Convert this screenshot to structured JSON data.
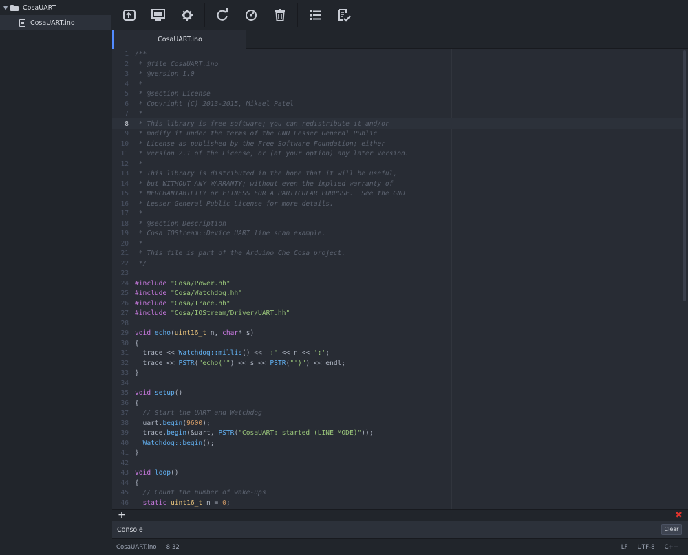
{
  "sidebar": {
    "project": "CosaUART",
    "file": "CosaUART.ino"
  },
  "toolbar": {
    "buttons": [
      "upload-icon",
      "serial-monitor-icon",
      "settings-icon",
      "refresh-icon",
      "verify-icon",
      "delete-icon",
      "list-icon",
      "edit-list-icon"
    ]
  },
  "tab": {
    "title": "CosaUART.ino"
  },
  "editor": {
    "cursor_line": 8,
    "lines": [
      [
        [
          "com",
          "/**"
        ]
      ],
      [
        [
          "com",
          " * @file CosaUART.ino"
        ]
      ],
      [
        [
          "com",
          " * @version 1.0"
        ]
      ],
      [
        [
          "com",
          " *"
        ]
      ],
      [
        [
          "com",
          " * @section License"
        ]
      ],
      [
        [
          "com",
          " * Copyright (C) 2013-2015, Mikael Patel"
        ]
      ],
      [
        [
          "com",
          " *"
        ]
      ],
      [
        [
          "com",
          " * This library is free software; you can redistribute it and/or"
        ]
      ],
      [
        [
          "com",
          " * modify it under the terms of the GNU Lesser General Public"
        ]
      ],
      [
        [
          "com",
          " * License as published by the Free Software Foundation; either"
        ]
      ],
      [
        [
          "com",
          " * version 2.1 of the License, or (at your option) any later version."
        ]
      ],
      [
        [
          "com",
          " *"
        ]
      ],
      [
        [
          "com",
          " * This library is distributed in the hope that it will be useful,"
        ]
      ],
      [
        [
          "com",
          " * but WITHOUT ANY WARRANTY; without even the implied warranty of"
        ]
      ],
      [
        [
          "com",
          " * MERCHANTABILITY or FITNESS FOR A PARTICULAR PURPOSE.  See the GNU"
        ]
      ],
      [
        [
          "com",
          " * Lesser General Public License for more details."
        ]
      ],
      [
        [
          "com",
          " *"
        ]
      ],
      [
        [
          "com",
          " * @section Description"
        ]
      ],
      [
        [
          "com",
          " * Cosa IOStream::Device UART line scan example."
        ]
      ],
      [
        [
          "com",
          " *"
        ]
      ],
      [
        [
          "com",
          " * This file is part of the Arduino Che Cosa project."
        ]
      ],
      [
        [
          "com",
          " */"
        ]
      ],
      [],
      [
        [
          "pre",
          "#include "
        ],
        [
          "str",
          "\"Cosa/Power.hh\""
        ]
      ],
      [
        [
          "pre",
          "#include "
        ],
        [
          "str",
          "\"Cosa/Watchdog.hh\""
        ]
      ],
      [
        [
          "pre",
          "#include "
        ],
        [
          "str",
          "\"Cosa/Trace.hh\""
        ]
      ],
      [
        [
          "pre",
          "#include "
        ],
        [
          "str",
          "\"Cosa/IOStream/Driver/UART.hh\""
        ]
      ],
      [],
      [
        [
          "kw",
          "void "
        ],
        [
          "fn",
          "echo"
        ],
        [
          "plain",
          "("
        ],
        [
          "typ",
          "uint16_t"
        ],
        [
          "plain",
          " n, "
        ],
        [
          "kw",
          "char"
        ],
        [
          "plain",
          "* s)"
        ]
      ],
      [
        [
          "plain",
          "{"
        ]
      ],
      [
        [
          "plain",
          "  trace << "
        ],
        [
          "ns",
          "Watchdog::millis"
        ],
        [
          "plain",
          "() << "
        ],
        [
          "str",
          "':'"
        ],
        [
          "plain",
          " << n << "
        ],
        [
          "str",
          "':'"
        ],
        [
          "plain",
          ";"
        ]
      ],
      [
        [
          "plain",
          "  trace << "
        ],
        [
          "fn",
          "PSTR"
        ],
        [
          "plain",
          "("
        ],
        [
          "str",
          "\"echo('\""
        ],
        [
          "plain",
          ") << s << "
        ],
        [
          "fn",
          "PSTR"
        ],
        [
          "plain",
          "("
        ],
        [
          "str",
          "\"')\""
        ],
        [
          "plain",
          ") << endl;"
        ]
      ],
      [
        [
          "plain",
          "}"
        ]
      ],
      [],
      [
        [
          "kw",
          "void "
        ],
        [
          "fn",
          "setup"
        ],
        [
          "plain",
          "()"
        ]
      ],
      [
        [
          "plain",
          "{"
        ]
      ],
      [
        [
          "com",
          "  // Start the UART and Watchdog"
        ]
      ],
      [
        [
          "plain",
          "  uart."
        ],
        [
          "fn",
          "begin"
        ],
        [
          "plain",
          "("
        ],
        [
          "num",
          "9600"
        ],
        [
          "plain",
          ");"
        ]
      ],
      [
        [
          "plain",
          "  trace."
        ],
        [
          "fn",
          "begin"
        ],
        [
          "plain",
          "(&uart, "
        ],
        [
          "fn",
          "PSTR"
        ],
        [
          "plain",
          "("
        ],
        [
          "str",
          "\"CosaUART: started (LINE MODE)\""
        ],
        [
          "plain",
          "));"
        ]
      ],
      [
        [
          "plain",
          "  "
        ],
        [
          "ns",
          "Watchdog::begin"
        ],
        [
          "plain",
          "();"
        ]
      ],
      [
        [
          "plain",
          "}"
        ]
      ],
      [],
      [
        [
          "kw",
          "void "
        ],
        [
          "fn",
          "loop"
        ],
        [
          "plain",
          "()"
        ]
      ],
      [
        [
          "plain",
          "{"
        ]
      ],
      [
        [
          "com",
          "  // Count the number of wake-ups"
        ]
      ],
      [
        [
          "plain",
          "  "
        ],
        [
          "kw",
          "static "
        ],
        [
          "typ",
          "uint16_t"
        ],
        [
          "plain",
          " n = "
        ],
        [
          "num",
          "0"
        ],
        [
          "plain",
          ";"
        ]
      ]
    ]
  },
  "console": {
    "add_label": "+",
    "close_label": "✖",
    "title": "Console",
    "clear_label": "Clear"
  },
  "status": {
    "file": "CosaUART.ino",
    "position": "8:32",
    "line_ending": "LF",
    "encoding": "UTF-8",
    "grammar": "C++"
  }
}
